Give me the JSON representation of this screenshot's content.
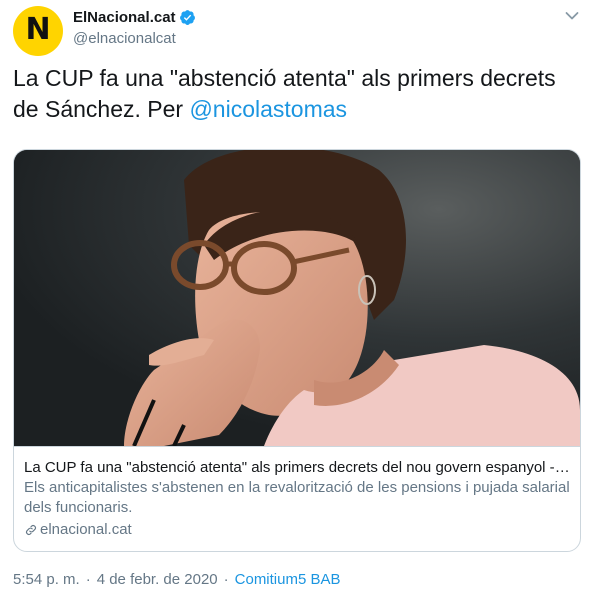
{
  "account": {
    "avatar_letter": "N",
    "display_name": "ElNacional.cat",
    "handle": "@elnacionalcat",
    "verified": true,
    "avatar_color": "#ffd400"
  },
  "tweet": {
    "text": "La CUP fa una \"abstenció atenta\" als primers decrets de Sánchez. Per ",
    "mention": "@nicolastomas"
  },
  "card": {
    "image_description": "photo",
    "title": "La CUP fa una \"abstenció atenta\" als primers decrets del nou govern espanyol - ...",
    "description": "Els anticapitalistes s'abstenen en la revalorització de les pensions i pujada salarial dels funcionaris.",
    "domain": "elnacional.cat"
  },
  "meta": {
    "time": "5:54 p. m.",
    "separator": "·",
    "date": "4 de febr. de 2020",
    "source": "Comitium5 BAB"
  },
  "colors": {
    "link": "#1b95e0",
    "secondary_text": "#657786",
    "verified": "#1da1f2"
  },
  "icons": [
    "verified-badge-icon",
    "caret-down-icon",
    "link-icon"
  ]
}
